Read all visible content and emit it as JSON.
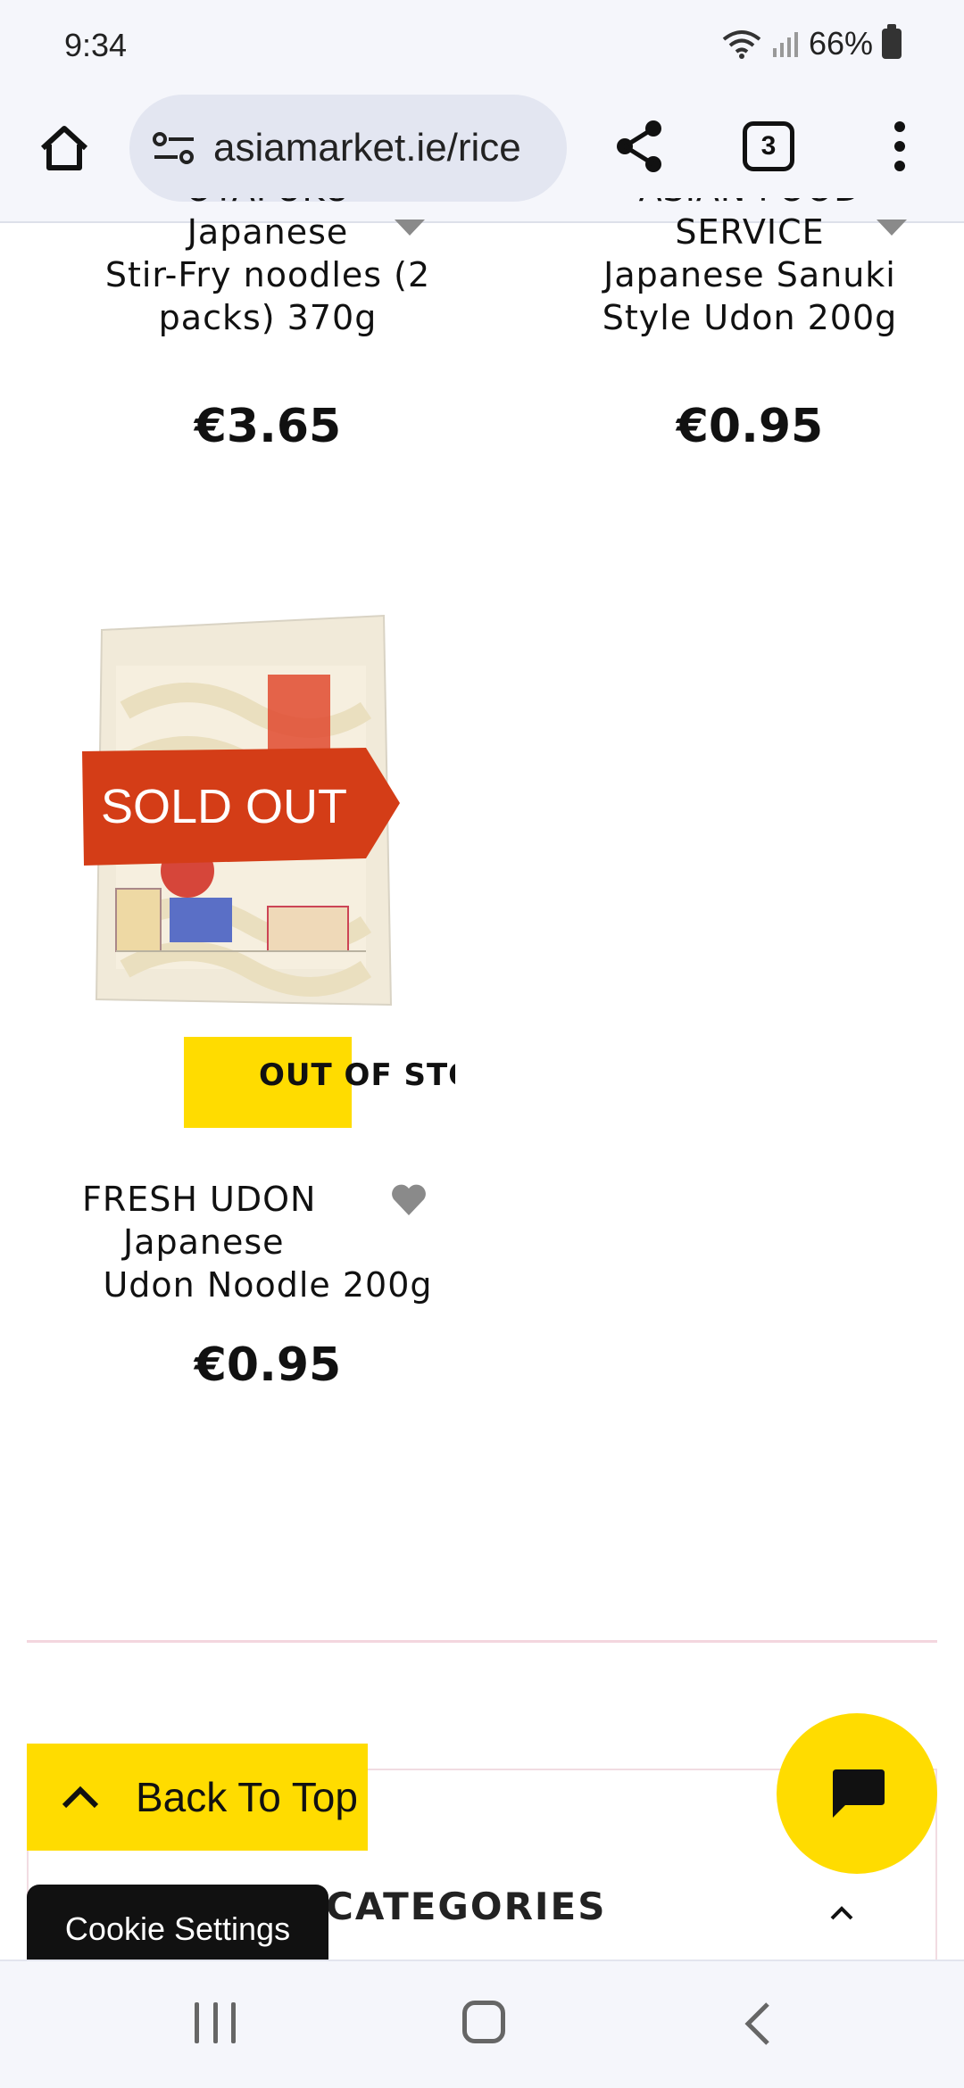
{
  "status_bar": {
    "time": "9:34",
    "battery": "66%"
  },
  "browser": {
    "url": "asiamarket.ie/rice",
    "tab_count": "3"
  },
  "products": [
    {
      "title_line1": "OTAFUKU",
      "title_line2": "Japanese",
      "title_line3": "Stir-Fry noodles (2",
      "title_line4": "packs) 370g",
      "price": "€3.65"
    },
    {
      "title_line1": "ASIAN FOOD",
      "title_line2": "SERVICE",
      "title_line3": "Japanese Sanuki",
      "title_line4": "Style Udon 200g",
      "price": "€0.95"
    },
    {
      "badge": "SOLD OUT",
      "stock": "OUT OF STOCK",
      "title_line1": "FRESH UDON",
      "title_line2": "Japanese",
      "title_line3": "Udon Noodle 200g",
      "price": "€0.95"
    }
  ],
  "categories": {
    "title": "CATEGORIES"
  },
  "back_to_top": {
    "label": "Back To Top"
  },
  "cookie": {
    "label": "Cookie Settings"
  },
  "colors": {
    "accent": "#ffdc00",
    "sold_out": "#d43d17"
  },
  "icons": {
    "home": "home-icon",
    "share": "share-icon",
    "chat": "chat-icon",
    "heart": "heart-icon"
  }
}
